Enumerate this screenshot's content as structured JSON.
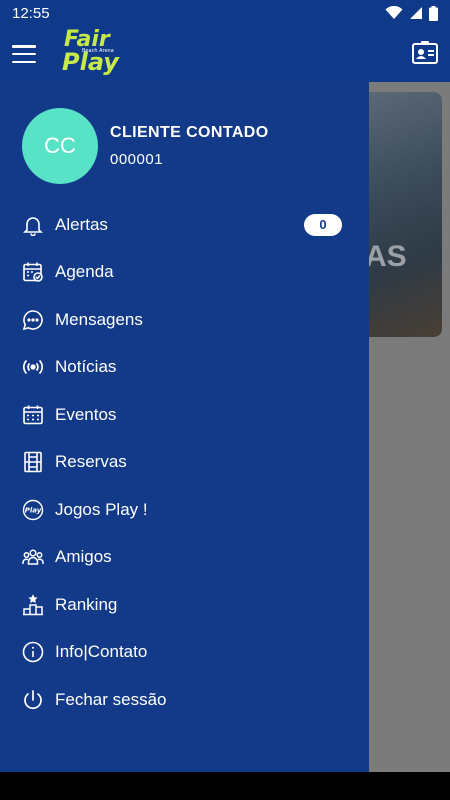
{
  "status_bar": {
    "time": "12:55"
  },
  "app_bar": {
    "logo_line1": "Fair",
    "logo_line2": "Play",
    "logo_sub": "Beach Arena"
  },
  "banner": {
    "partial_text": "AS"
  },
  "profile": {
    "initials": "CC",
    "name": "CLIENTE CONTADO",
    "id": "000001"
  },
  "menu": [
    {
      "label": "Alertas",
      "icon": "bell-icon",
      "badge": "0"
    },
    {
      "label": "Agenda",
      "icon": "calendar-check-icon"
    },
    {
      "label": "Mensagens",
      "icon": "chat-bubble-icon"
    },
    {
      "label": "Notícias",
      "icon": "broadcast-icon"
    },
    {
      "label": "Eventos",
      "icon": "calendar-grid-icon"
    },
    {
      "label": "Reservas",
      "icon": "court-icon"
    },
    {
      "label": "Jogos Play !",
      "icon": "play-badge-icon"
    },
    {
      "label": "Amigos",
      "icon": "people-icon"
    },
    {
      "label": "Ranking",
      "icon": "podium-icon"
    },
    {
      "label": "Info|Contato",
      "icon": "info-icon"
    },
    {
      "label": "Fechar sessão",
      "icon": "power-icon"
    }
  ],
  "colors": {
    "primary": "#133a88",
    "accent": "#c6e84a",
    "avatar": "#58e3c7"
  }
}
